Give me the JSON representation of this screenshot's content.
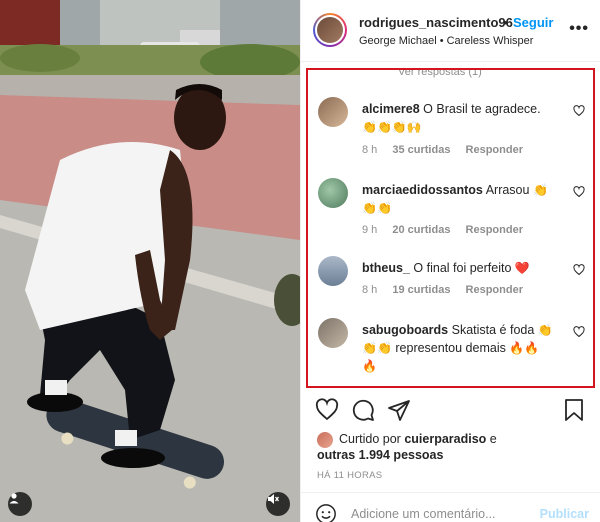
{
  "header": {
    "username": "rodrigues_nascimento96",
    "separator": "•",
    "follow_label": "Seguir",
    "song": "George Michael • Careless Whisper",
    "more_icon": "more-horizontal-icon"
  },
  "comments": {
    "view_replies": "Ver respostas (1)",
    "items": [
      {
        "user": "alcimere8",
        "text": "O Brasil te agradece.",
        "emoji": "👏👏👏🙌",
        "time": "8 h",
        "likes": "35 curtidas",
        "reply": "Responder"
      },
      {
        "user": "marciaedidossantos",
        "text": "Arrasou",
        "emoji": "👏👏👏",
        "time": "9 h",
        "likes": "20 curtidas",
        "reply": "Responder"
      },
      {
        "user": "btheus_",
        "text": "O final foi perfeito",
        "emoji": "❤️",
        "time": "8 h",
        "likes": "19 curtidas",
        "reply": "Responder"
      },
      {
        "user": "sabugoboards",
        "text": "Skatista é foda",
        "emoji_a": "👏",
        "emoji_b": "👏👏",
        "text2": "representou demais",
        "emoji_c": "🔥🔥",
        "emoji_d": "🔥",
        "time": "",
        "likes": "",
        "reply": ""
      }
    ]
  },
  "likes": {
    "liked_by": "Curtido por",
    "liked_user": "cuierparadiso",
    "and": "e",
    "others": "outras 1.994 pessoas"
  },
  "timestamp": "HÁ 11 HORAS",
  "add_comment": {
    "placeholder": "Adicione um comentário...",
    "publish": "Publicar"
  },
  "colors": {
    "accent": "#0095f6",
    "highlight_border": "#d3161e",
    "heart": "#ed4956"
  },
  "icons": [
    "heart-icon",
    "comment-icon",
    "share-icon",
    "save-icon",
    "emoji-icon",
    "user-icon",
    "mute-icon"
  ]
}
